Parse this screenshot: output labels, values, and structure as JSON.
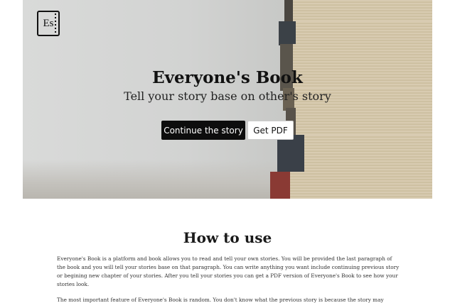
{
  "hero": {
    "logo_text": "Es",
    "title": "Everyone's Book",
    "subtitle": "Tell your story base on other's story",
    "primary_button": "Continue the story",
    "secondary_button": "Get PDF"
  },
  "how_to_use": {
    "title": "How to use",
    "paragraphs": [
      "Everyone's Book is a platform and book allows you to read and tell your own stories. You will be provided the last paragraph of the book and you will tell your stories base on that paragraph. You can write anything you want include continuing previous story or begining new chapter of your stories. After you tell your stories you can get a PDF version of Everyone's Book to see how your stories look.",
      "The most important feature of Everyone's Book is random. You don't know what the previous story is because the story may"
    ]
  },
  "colors": {
    "primary_button_bg": "#0d0d0d",
    "hero_bg": "#d2d3d2",
    "page_bg": "#ffffff"
  },
  "icons": {
    "logo": "notebook-logo-icon"
  }
}
